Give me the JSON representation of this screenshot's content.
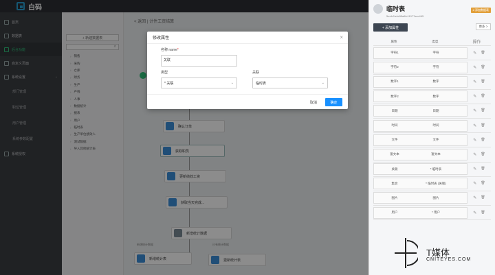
{
  "app": {
    "logo_text": "白码"
  },
  "sidebar": {
    "items": [
      {
        "label": "首页",
        "active": false
      },
      {
        "label": "数据表",
        "active": false
      },
      {
        "label": "后台功能",
        "active": true
      },
      {
        "label": "自定义页面",
        "active": false
      },
      {
        "label": "系统设置",
        "active": false,
        "expanded": true
      }
    ],
    "sub_items": [
      "部门管理",
      "职位管理",
      "用户管理",
      "系统参数配置",
      "系统授权"
    ]
  },
  "tree": {
    "new_button": "+ 新建数据表",
    "search_icon": "search-icon",
    "items": [
      "销售",
      "采购",
      "仓库",
      "财务",
      "生产",
      "产线",
      "人事",
      "数据统计",
      "报表",
      "用户",
      "临时表",
      "生产单位绩效人",
      "测试数据",
      "导入其他统计表"
    ]
  },
  "canvas": {
    "breadcrumb": "< 返回   |  计件工资结算",
    "nodes": [
      "确认订单",
      "获取职员",
      "更新绩效工资",
      "获取当天完成...",
      "新增统计数据",
      "新增统计表",
      "更新统计表"
    ],
    "branch_labels": [
      "新增统计数据",
      "已有统计数据"
    ]
  },
  "right_panel": {
    "title": "临时表",
    "subtitle": "5ecfc2a4e88a6fc11077acc465",
    "badge": "# 添加数据表",
    "add_button": "+ 添加属性",
    "more_button": "更多 >",
    "columns": [
      "属性",
      "类型",
      "操作"
    ],
    "rows": [
      {
        "name": "字符1",
        "type": "字符"
      },
      {
        "name": "字符2",
        "type": "字符"
      },
      {
        "name": "数字1",
        "type": "数字"
      },
      {
        "name": "数字2",
        "type": "数字"
      },
      {
        "name": "日期",
        "type": "日期"
      },
      {
        "name": "时间",
        "type": "时间"
      },
      {
        "name": "文件",
        "type": "文件"
      },
      {
        "name": "富文本",
        "type": "富文本"
      },
      {
        "name": "关联",
        "type": "* 临时表"
      },
      {
        "name": "集合",
        "type": "* 临时表 (关联)"
      },
      {
        "name": "图片",
        "type": "图片"
      },
      {
        "name": "用户",
        "type": "* 用户"
      }
    ]
  },
  "modal": {
    "title": "修改属性",
    "name_label": "名称 name",
    "name_required": "*",
    "name_value": "关联",
    "type_label": "类型",
    "type_value": "* 关联",
    "relation_label": "关联",
    "relation_value": "临时表",
    "cancel": "取消",
    "ok": "确定"
  },
  "watermark": {
    "brand": "T媒体",
    "url": "CNITEYES.COM"
  }
}
